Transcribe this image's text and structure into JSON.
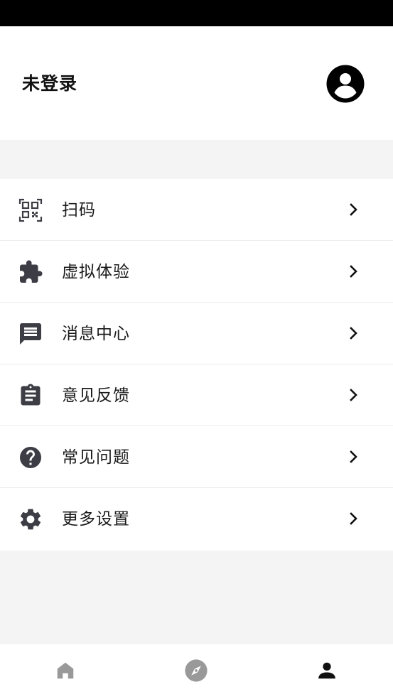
{
  "header": {
    "login_status": "未登录",
    "avatar_icon": "account-circle-icon"
  },
  "menu": {
    "items": [
      {
        "label": "扫码",
        "icon": "qr-scan-icon"
      },
      {
        "label": "虚拟体验",
        "icon": "puzzle-icon"
      },
      {
        "label": "消息中心",
        "icon": "message-icon"
      },
      {
        "label": "意见反馈",
        "icon": "clipboard-icon"
      },
      {
        "label": "常见问题",
        "icon": "help-circle-icon"
      },
      {
        "label": "更多设置",
        "icon": "gear-icon"
      }
    ],
    "chevron_icon": "chevron-right-icon"
  },
  "bottom_nav": {
    "tabs": [
      {
        "icon": "home-icon",
        "active": false
      },
      {
        "icon": "compass-icon",
        "active": false
      },
      {
        "icon": "person-icon",
        "active": true
      }
    ],
    "active_color": "#111111",
    "inactive_color": "#999999"
  },
  "colors": {
    "status_bar": "#000000",
    "background": "#f4f4f4",
    "card": "#ffffff",
    "icon": "#3d3d45"
  }
}
